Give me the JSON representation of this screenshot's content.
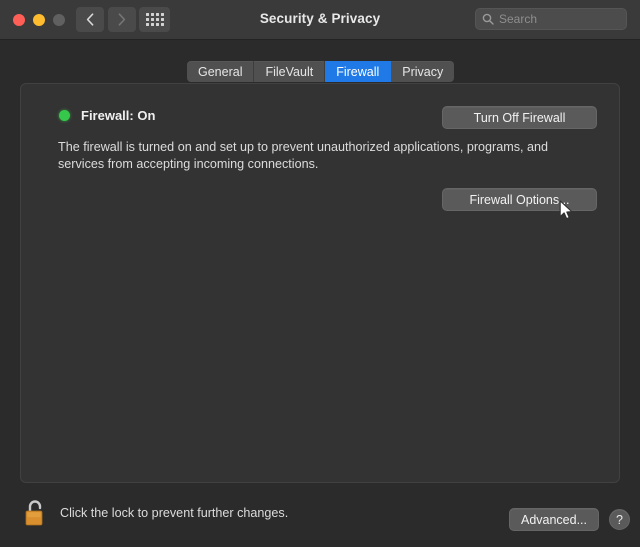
{
  "window": {
    "title": "Security & Privacy",
    "traffic_lights": [
      {
        "name": "close",
        "color": "#ff5f57"
      },
      {
        "name": "minimize",
        "color": "#febc2e"
      },
      {
        "name": "zoom",
        "color": "#606060"
      }
    ],
    "nav": {
      "back_label": "‹",
      "forward_label": "›",
      "show_all_label": "Show All"
    }
  },
  "search": {
    "placeholder": "Search",
    "value": ""
  },
  "tabs": [
    {
      "label": "General",
      "active": false
    },
    {
      "label": "FileVault",
      "active": false
    },
    {
      "label": "Firewall",
      "active": true
    },
    {
      "label": "Privacy",
      "active": false
    }
  ],
  "firewall": {
    "status_label": "Firewall: On",
    "status_color": "#35c84a",
    "description": "The firewall is turned on and set up to prevent unauthorized applications, programs, and services from accepting incoming connections.",
    "turn_off_button": "Turn Off Firewall",
    "options_button": "Firewall Options..."
  },
  "footer": {
    "lock_state": "unlocked",
    "lock_text": "Click the lock to prevent further changes.",
    "advanced_button": "Advanced...",
    "help_button": "?"
  },
  "accent_color": "#1f79e6"
}
